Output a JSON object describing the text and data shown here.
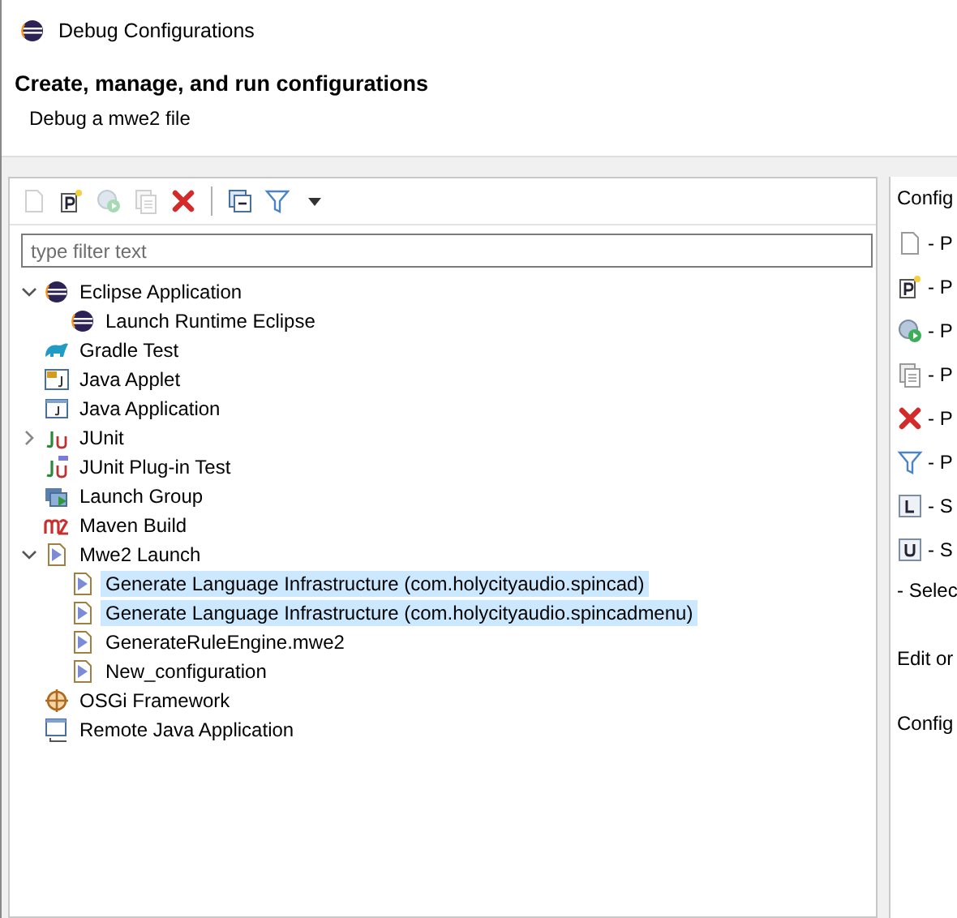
{
  "window": {
    "title": "Debug Configurations"
  },
  "header": {
    "title": "Create, manage, and run configurations",
    "message": "Debug a mwe2 file"
  },
  "toolbar": [
    {
      "kind": "new",
      "disabled": true
    },
    {
      "kind": "prototype",
      "disabled": false
    },
    {
      "kind": "export",
      "disabled": true
    },
    {
      "kind": "duplicate",
      "disabled": true
    },
    {
      "kind": "delete",
      "disabled": false
    },
    {
      "kind": "collapse",
      "disabled": false
    },
    {
      "kind": "filter",
      "disabled": false
    },
    {
      "kind": "menu",
      "disabled": false
    }
  ],
  "filter": {
    "placeholder": "type filter text"
  },
  "tree": [
    {
      "label": "Eclipse Application",
      "kind": "eclipse",
      "expanded": true,
      "selected": false,
      "children": [
        {
          "label": "Launch Runtime Eclipse",
          "kind": "eclipse",
          "selected": false
        }
      ]
    },
    {
      "label": "Gradle Test",
      "kind": "gradle",
      "selected": false
    },
    {
      "label": "Java Applet",
      "kind": "applet",
      "selected": false
    },
    {
      "label": "Java Application",
      "kind": "java",
      "selected": false
    },
    {
      "label": "JUnit",
      "kind": "junit",
      "expanded": false,
      "selected": false
    },
    {
      "label": "JUnit Plug-in Test",
      "kind": "junitplugin",
      "selected": false
    },
    {
      "label": "Launch Group",
      "kind": "group",
      "selected": false
    },
    {
      "label": "Maven Build",
      "kind": "maven",
      "selected": false
    },
    {
      "label": "Mwe2 Launch",
      "kind": "mwe2",
      "expanded": true,
      "selected": false,
      "children": [
        {
          "label": "Generate Language Infrastructure (com.holycityaudio.spincad)",
          "kind": "mwe2",
          "selected": true
        },
        {
          "label": "Generate Language Infrastructure (com.holycityaudio.spincadmenu)",
          "kind": "mwe2",
          "selected": true
        },
        {
          "label": "GenerateRuleEngine.mwe2",
          "kind": "mwe2",
          "selected": false
        },
        {
          "label": "New_configuration",
          "kind": "mwe2",
          "selected": false
        }
      ]
    },
    {
      "label": "OSGi Framework",
      "kind": "osgi",
      "selected": false
    },
    {
      "label": "Remote Java Application",
      "kind": "remote",
      "selected": false
    }
  ],
  "side_panel": {
    "title": "Config",
    "items": [
      {
        "kind": "new",
        "text": "- P"
      },
      {
        "kind": "prototype",
        "text": "- P"
      },
      {
        "kind": "export",
        "text": "- P"
      },
      {
        "kind": "duplicate",
        "text": "- P"
      },
      {
        "kind": "delete",
        "text": "- P"
      },
      {
        "kind": "filter",
        "text": "- P"
      },
      {
        "kind": "link",
        "text": "- S"
      },
      {
        "kind": "unlink",
        "text": "- S"
      }
    ],
    "select_text": "- Selec",
    "edit_text": "Edit or",
    "footer_text": "Config"
  }
}
